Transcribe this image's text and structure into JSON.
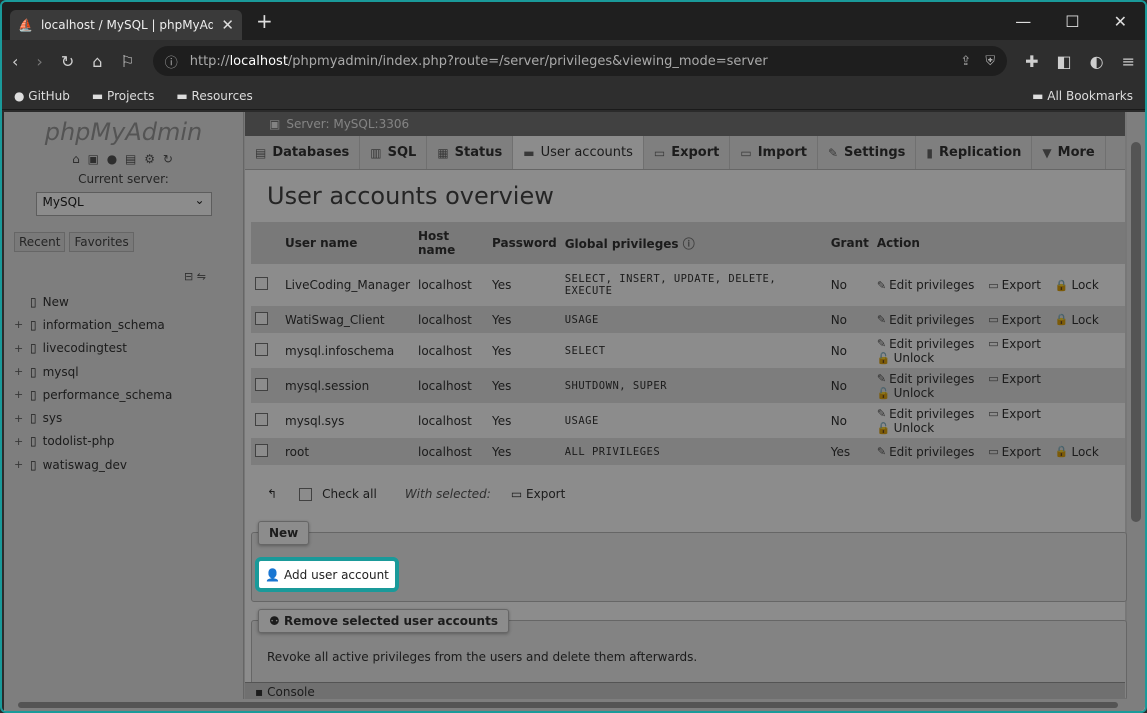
{
  "browser": {
    "tab_title": "localhost / MySQL | phpMyAdm",
    "url_prefix": "http://",
    "url_host": "localhost",
    "url_path": "/phpmyadmin/index.php?route=/server/privileges&viewing_mode=server",
    "bookmarks": [
      "GitHub",
      "Projects",
      "Resources"
    ],
    "all_bookmarks": "All Bookmarks"
  },
  "sidebar": {
    "logo_php": "php",
    "logo_myadmin": "MyAdmin",
    "current_server_label": "Current server:",
    "server_value": "MySQL",
    "recent": "Recent",
    "favorites": "Favorites",
    "tree": [
      {
        "name": "New",
        "expand": ""
      },
      {
        "name": "information_schema",
        "expand": "+"
      },
      {
        "name": "livecodingtest",
        "expand": "+"
      },
      {
        "name": "mysql",
        "expand": "+"
      },
      {
        "name": "performance_schema",
        "expand": "+"
      },
      {
        "name": "sys",
        "expand": "+"
      },
      {
        "name": "todolist-php",
        "expand": "+"
      },
      {
        "name": "watiswag_dev",
        "expand": "+"
      }
    ]
  },
  "server_bar": "Server: MySQL:3306",
  "nav_tabs": [
    {
      "label": "Databases",
      "icon": "▤"
    },
    {
      "label": "SQL",
      "icon": "▥"
    },
    {
      "label": "Status",
      "icon": "▦"
    },
    {
      "label": "User accounts",
      "icon": "▬"
    },
    {
      "label": "Export",
      "icon": "▭"
    },
    {
      "label": "Import",
      "icon": "▭"
    },
    {
      "label": "Settings",
      "icon": "✎"
    },
    {
      "label": "Replication",
      "icon": "▮"
    },
    {
      "label": "More",
      "icon": "▼"
    }
  ],
  "page_title": "User accounts overview",
  "table": {
    "headers": {
      "username": "User name",
      "host": "Host name",
      "password": "Password",
      "privileges": "Global privileges",
      "grant": "Grant",
      "action": "Action"
    },
    "rows": [
      {
        "user": "LiveCoding_Manager",
        "host": "localhost",
        "password": "Yes",
        "privileges": "SELECT, INSERT, UPDATE, DELETE, EXECUTE",
        "grant": "No",
        "lock": "Lock"
      },
      {
        "user": "WatiSwag_Client",
        "host": "localhost",
        "password": "Yes",
        "privileges": "USAGE",
        "grant": "No",
        "lock": "Lock"
      },
      {
        "user": "mysql.infoschema",
        "host": "localhost",
        "password": "Yes",
        "privileges": "SELECT",
        "grant": "No",
        "lock": "Unlock"
      },
      {
        "user": "mysql.session",
        "host": "localhost",
        "password": "Yes",
        "privileges": "SHUTDOWN, SUPER",
        "grant": "No",
        "lock": "Unlock"
      },
      {
        "user": "mysql.sys",
        "host": "localhost",
        "password": "Yes",
        "privileges": "USAGE",
        "grant": "No",
        "lock": "Unlock"
      },
      {
        "user": "root",
        "host": "localhost",
        "password": "Yes",
        "privileges": "ALL PRIVILEGES",
        "grant": "Yes",
        "lock": "Lock"
      }
    ],
    "edit_label": "Edit privileges",
    "export_label": "Export"
  },
  "footer": {
    "check_all": "Check all",
    "with_selected": "With selected:",
    "export": "Export"
  },
  "new_section": {
    "legend": "New",
    "add_user": "Add user account"
  },
  "remove_section": {
    "legend": "Remove selected user accounts",
    "description": "Revoke all active privileges from the users and delete them afterwards."
  },
  "console": "Console"
}
